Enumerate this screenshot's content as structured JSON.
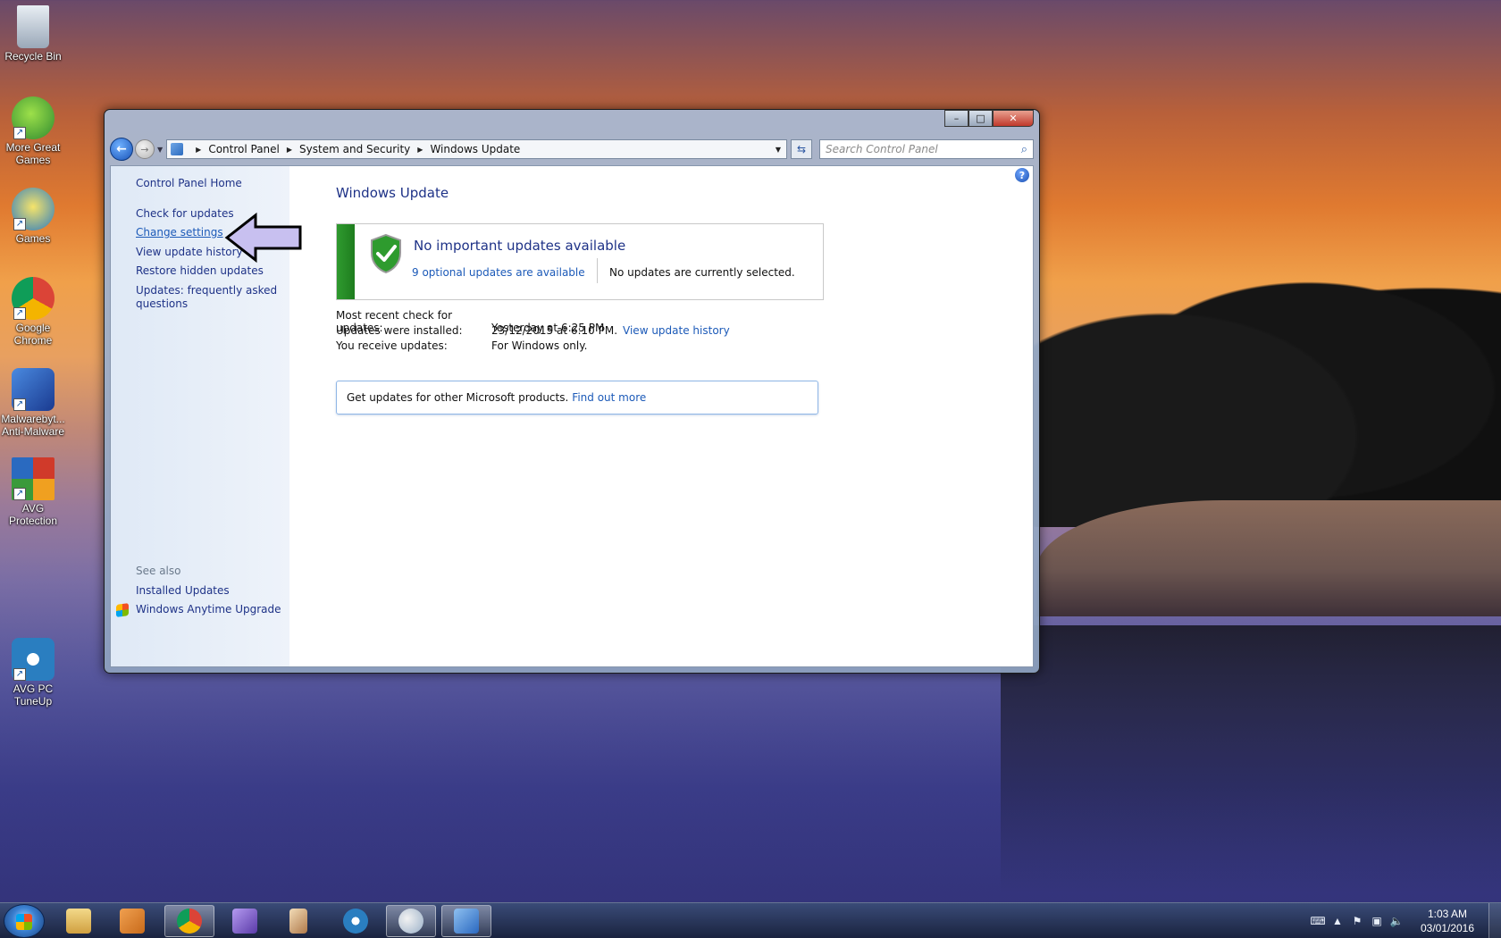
{
  "desktop": {
    "icons": [
      {
        "label": "Recycle Bin"
      },
      {
        "label": "More Great Games"
      },
      {
        "label": "Games"
      },
      {
        "label": "Google Chrome"
      },
      {
        "label": "Malwarebyt... Anti-Malware"
      },
      {
        "label": "AVG Protection"
      },
      {
        "label": "AVG PC TuneUp"
      }
    ]
  },
  "window": {
    "controls": {
      "minimize": "–",
      "maximize": "□",
      "close": "✕"
    },
    "breadcrumbs": [
      "Control Panel",
      "System and Security",
      "Windows Update"
    ],
    "search_placeholder": "Search Control Panel",
    "sidebar": {
      "home": "Control Panel Home",
      "items": [
        {
          "label": "Check for updates"
        },
        {
          "label": "Change settings"
        },
        {
          "label": "View update history"
        },
        {
          "label": "Restore hidden updates"
        },
        {
          "label": "Updates: frequently asked questions"
        }
      ],
      "see_also_heading": "See also",
      "see_also": [
        {
          "label": "Installed Updates"
        },
        {
          "label": "Windows Anytime Upgrade"
        }
      ]
    },
    "main": {
      "title": "Windows Update",
      "status": {
        "title": "No important updates available",
        "optional_link": "9 optional updates are available",
        "selection_text": "No updates are currently selected.",
        "color": "#2f9a2f"
      },
      "info": [
        {
          "label": "Most recent check for updates:",
          "value": "Yesterday at 6:25 PM"
        },
        {
          "label": "Updates were installed:",
          "value": "23/12/2015 at 6:10 PM.",
          "link": "View update history"
        },
        {
          "label": "You receive updates:",
          "value": "For Windows only."
        }
      ],
      "more_box": {
        "text": "Get updates for other Microsoft products.",
        "link": "Find out more"
      }
    }
  },
  "taskbar": {
    "apps": [
      {
        "name": "windows-explorer",
        "color": "#e8c060"
      },
      {
        "name": "media-player",
        "color": "#e08a2a"
      },
      {
        "name": "google-chrome",
        "color": "#dd4433"
      },
      {
        "name": "app-purple",
        "color": "#8a6ad0"
      },
      {
        "name": "app-cards",
        "color": "#d0a070"
      },
      {
        "name": "avg-tuneup",
        "color": "#2a7ec0"
      },
      {
        "name": "paint",
        "color": "#7aa0c8"
      },
      {
        "name": "control-panel",
        "color": "#4a88d0"
      }
    ],
    "clock_time": "1:03 AM",
    "clock_date": "03/01/2016"
  }
}
